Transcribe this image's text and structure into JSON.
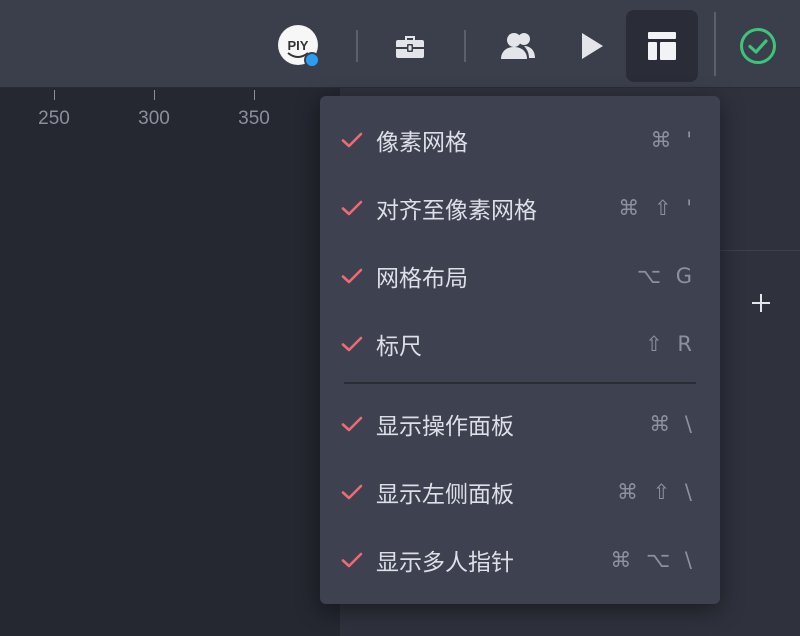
{
  "toolbar": {
    "avatar_text": "PIY",
    "icons": [
      "avatar",
      "briefcase-icon",
      "users-icon",
      "play-icon",
      "layout-icon",
      "check-circle-icon"
    ]
  },
  "ruler": {
    "labels": [
      "250",
      "300",
      "350"
    ]
  },
  "menu": {
    "items": [
      {
        "label": "像素网格",
        "shortcut": "⌘ '",
        "checked": true
      },
      {
        "label": "对齐至像素网格",
        "shortcut": "⌘ ⇧ '",
        "checked": true
      },
      {
        "label": "网格布局",
        "shortcut": "⌥ G",
        "checked": true
      },
      {
        "label": "标尺",
        "shortcut": "⇧ R",
        "checked": true
      },
      {
        "label": "显示操作面板",
        "shortcut": "⌘ \\",
        "checked": true
      },
      {
        "label": "显示左侧面板",
        "shortcut": "⌘ ⇧ \\",
        "checked": true
      },
      {
        "label": "显示多人指针",
        "shortcut": "⌘ ⌥ \\",
        "checked": true
      }
    ]
  },
  "colors": {
    "check": "#f06a73",
    "status_ok": "#3ec47a",
    "avatar_badge": "#2a9ff2"
  }
}
